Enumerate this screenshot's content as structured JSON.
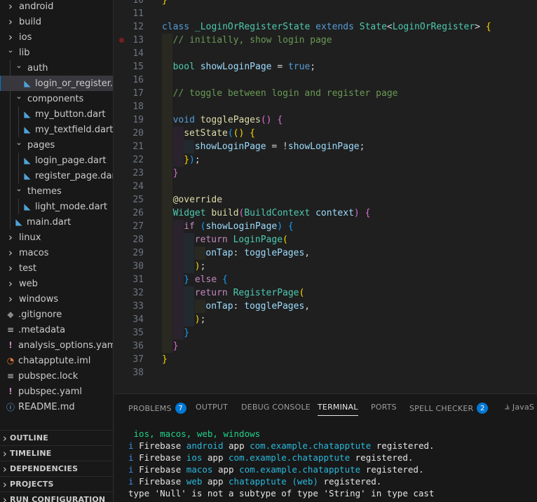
{
  "explorer": {
    "items": [
      {
        "label": "android",
        "type": "folder",
        "open": false,
        "depth": 0
      },
      {
        "label": "build",
        "type": "folder",
        "open": false,
        "depth": 0
      },
      {
        "label": "ios",
        "type": "folder",
        "open": false,
        "depth": 0
      },
      {
        "label": "lib",
        "type": "folder",
        "open": true,
        "depth": 0
      },
      {
        "label": "auth",
        "type": "folder",
        "open": true,
        "depth": 1
      },
      {
        "label": "login_or_register.d...",
        "type": "dart",
        "depth": 2,
        "selected": true
      },
      {
        "label": "components",
        "type": "folder",
        "open": true,
        "depth": 1
      },
      {
        "label": "my_button.dart",
        "type": "dart",
        "depth": 2
      },
      {
        "label": "my_textfield.dart",
        "type": "dart",
        "depth": 2
      },
      {
        "label": "pages",
        "type": "folder",
        "open": true,
        "depth": 1
      },
      {
        "label": "login_page.dart",
        "type": "dart",
        "depth": 2
      },
      {
        "label": "register_page.dart",
        "type": "dart",
        "depth": 2
      },
      {
        "label": "themes",
        "type": "folder",
        "open": true,
        "depth": 1
      },
      {
        "label": "light_mode.dart",
        "type": "dart",
        "depth": 2
      },
      {
        "label": "main.dart",
        "type": "dart",
        "depth": 1
      },
      {
        "label": "linux",
        "type": "folder",
        "open": false,
        "depth": 0
      },
      {
        "label": "macos",
        "type": "folder",
        "open": false,
        "depth": 0
      },
      {
        "label": "test",
        "type": "folder",
        "open": false,
        "depth": 0
      },
      {
        "label": "web",
        "type": "folder",
        "open": false,
        "depth": 0
      },
      {
        "label": "windows",
        "type": "folder",
        "open": false,
        "depth": 0
      },
      {
        "label": ".gitignore",
        "type": "git",
        "depth": 0
      },
      {
        "label": ".metadata",
        "type": "lines",
        "depth": 0
      },
      {
        "label": "analysis_options.yaml",
        "type": "yaml",
        "depth": 0
      },
      {
        "label": "chatapptute.iml",
        "type": "rss",
        "depth": 0
      },
      {
        "label": "pubspec.lock",
        "type": "lines",
        "depth": 0
      },
      {
        "label": "pubspec.yaml",
        "type": "yaml",
        "depth": 0
      },
      {
        "label": "README.md",
        "type": "info",
        "depth": 0
      }
    ],
    "sections": [
      "OUTLINE",
      "TIMELINE",
      "DEPENDENCIES",
      "PROJECTS",
      "RUN CONFIGURATION"
    ]
  },
  "editor": {
    "lines": [
      {
        "n": "10",
        "indent": 0,
        "tokens": [
          [
            "}",
            "b1"
          ]
        ]
      },
      {
        "n": "11",
        "indent": 0,
        "tokens": []
      },
      {
        "n": "12",
        "indent": 0,
        "tokens": [
          [
            "class ",
            "kw"
          ],
          [
            "_LoginOrRegisterState ",
            "ty"
          ],
          [
            "extends ",
            "kw"
          ],
          [
            "State",
            "ty"
          ],
          [
            "<",
            "pl"
          ],
          [
            "LoginOrRegister",
            "ty"
          ],
          [
            "> ",
            "pl"
          ],
          [
            "{",
            "b1"
          ]
        ]
      },
      {
        "n": "13",
        "indent": 1,
        "breakpoint": true,
        "tokens": [
          [
            "// initially, show login page",
            "cm"
          ]
        ]
      },
      {
        "n": "14",
        "indent": 1,
        "tokens": []
      },
      {
        "n": "15",
        "indent": 1,
        "tokens": [
          [
            "bool ",
            "ty"
          ],
          [
            "showLoginPage ",
            "va"
          ],
          [
            "= ",
            "pl"
          ],
          [
            "true",
            "kw"
          ],
          [
            ";",
            "pl"
          ]
        ]
      },
      {
        "n": "16",
        "indent": 1,
        "tokens": []
      },
      {
        "n": "17",
        "indent": 1,
        "tokens": [
          [
            "// toggle between login and register page",
            "cm"
          ]
        ]
      },
      {
        "n": "18",
        "indent": 1,
        "tokens": []
      },
      {
        "n": "19",
        "indent": 1,
        "tokens": [
          [
            "void ",
            "kw"
          ],
          [
            "togglePages",
            "fn"
          ],
          [
            "() ",
            "b2"
          ],
          [
            "{",
            "b2"
          ]
        ]
      },
      {
        "n": "20",
        "indent": 2,
        "tokens": [
          [
            "setState",
            "fn"
          ],
          [
            "(",
            "b3"
          ],
          [
            "() ",
            "b1"
          ],
          [
            "{",
            "b1"
          ]
        ]
      },
      {
        "n": "21",
        "indent": 3,
        "tokens": [
          [
            "showLoginPage ",
            "va"
          ],
          [
            "= !",
            "pl"
          ],
          [
            "showLoginPage",
            "va"
          ],
          [
            ";",
            "pl"
          ]
        ]
      },
      {
        "n": "22",
        "indent": 2,
        "tokens": [
          [
            "}",
            "b1"
          ],
          [
            ")",
            "b3"
          ],
          [
            ";",
            "pl"
          ]
        ]
      },
      {
        "n": "23",
        "indent": 1,
        "tokens": [
          [
            "}",
            "b2"
          ]
        ]
      },
      {
        "n": "24",
        "indent": 1,
        "tokens": []
      },
      {
        "n": "25",
        "indent": 1,
        "tokens": [
          [
            "@override",
            "an"
          ]
        ]
      },
      {
        "n": "26",
        "indent": 1,
        "tokens": [
          [
            "Widget ",
            "ty"
          ],
          [
            "build",
            "fn"
          ],
          [
            "(",
            "b2"
          ],
          [
            "BuildContext ",
            "ty"
          ],
          [
            "context",
            "va"
          ],
          [
            ") ",
            "b2"
          ],
          [
            "{",
            "b2"
          ]
        ]
      },
      {
        "n": "27",
        "indent": 2,
        "tokens": [
          [
            "if ",
            "kw2"
          ],
          [
            "(",
            "b3"
          ],
          [
            "showLoginPage",
            "va"
          ],
          [
            ") ",
            "b3"
          ],
          [
            "{",
            "b3"
          ]
        ]
      },
      {
        "n": "28",
        "indent": 3,
        "tokens": [
          [
            "return ",
            "kw2"
          ],
          [
            "LoginPage",
            "ty"
          ],
          [
            "(",
            "b1"
          ]
        ]
      },
      {
        "n": "29",
        "indent": 4,
        "tokens": [
          [
            "onTap",
            "va"
          ],
          [
            ": ",
            "pl"
          ],
          [
            "togglePages",
            "va"
          ],
          [
            ",",
            "pl"
          ]
        ]
      },
      {
        "n": "30",
        "indent": 3,
        "tokens": [
          [
            ")",
            "b1"
          ],
          [
            ";",
            "pl"
          ]
        ]
      },
      {
        "n": "31",
        "indent": 2,
        "tokens": [
          [
            "} ",
            "b3"
          ],
          [
            "else ",
            "kw2"
          ],
          [
            "{",
            "b3"
          ]
        ]
      },
      {
        "n": "32",
        "indent": 3,
        "tokens": [
          [
            "return ",
            "kw2"
          ],
          [
            "RegisterPage",
            "ty"
          ],
          [
            "(",
            "b1"
          ]
        ]
      },
      {
        "n": "33",
        "indent": 4,
        "tokens": [
          [
            "onTap",
            "va"
          ],
          [
            ": ",
            "pl"
          ],
          [
            "togglePages",
            "va"
          ],
          [
            ",",
            "pl"
          ]
        ]
      },
      {
        "n": "34",
        "indent": 3,
        "tokens": [
          [
            ")",
            "b1"
          ],
          [
            ";",
            "pl"
          ]
        ]
      },
      {
        "n": "35",
        "indent": 2,
        "tokens": [
          [
            "}",
            "b3"
          ]
        ]
      },
      {
        "n": "36",
        "indent": 1,
        "tokens": [
          [
            "}",
            "b2"
          ]
        ]
      },
      {
        "n": "37",
        "indent": 0,
        "tokens": [
          [
            "}",
            "b1"
          ]
        ]
      },
      {
        "n": "38",
        "indent": 0,
        "tokens": []
      }
    ]
  },
  "panel": {
    "tabs": [
      {
        "label": "PROBLEMS",
        "badge": "7"
      },
      {
        "label": "OUTPUT"
      },
      {
        "label": "DEBUG CONSOLE"
      },
      {
        "label": "TERMINAL",
        "active": true
      },
      {
        "label": "PORTS"
      },
      {
        "label": "SPELL CHECKER",
        "badge": "2"
      },
      {
        "label": "JavaS",
        "icon": true
      }
    ],
    "terminal": [
      [
        [
          " ios, macos, web, windows",
          "tgreen"
        ]
      ],
      [
        [
          "i ",
          "tinfo"
        ],
        [
          "Firebase ",
          ""
        ],
        [
          "android ",
          "tcyan"
        ],
        [
          "app ",
          ""
        ],
        [
          "com.example.chatapptute ",
          "tcyan"
        ],
        [
          "registered.",
          ""
        ]
      ],
      [
        [
          "i ",
          "tinfo"
        ],
        [
          "Firebase ",
          ""
        ],
        [
          "ios ",
          "tcyan"
        ],
        [
          "app ",
          ""
        ],
        [
          "com.example.chatapptute ",
          "tcyan"
        ],
        [
          "registered.",
          ""
        ]
      ],
      [
        [
          "i ",
          "tinfo"
        ],
        [
          "Firebase ",
          ""
        ],
        [
          "macos ",
          "tcyan"
        ],
        [
          "app ",
          ""
        ],
        [
          "com.example.chatapptute ",
          "tcyan"
        ],
        [
          "registered.",
          ""
        ]
      ],
      [
        [
          "i ",
          "tinfo"
        ],
        [
          "Firebase ",
          ""
        ],
        [
          "web ",
          "tcyan"
        ],
        [
          "app ",
          ""
        ],
        [
          "chatapptute (web) ",
          "tcyan"
        ],
        [
          "registered.",
          ""
        ]
      ],
      [
        [
          "type 'Null' is not a subtype of type 'String' in type cast",
          ""
        ]
      ]
    ]
  },
  "colors": {
    "accent": "#0078d4",
    "dart_icon": "#4fa3d9",
    "yaml_icon": "#c586c0",
    "rss_icon": "#e37933",
    "sidebar_bg": "#181818",
    "editor_bg": "#1f1f1f"
  }
}
